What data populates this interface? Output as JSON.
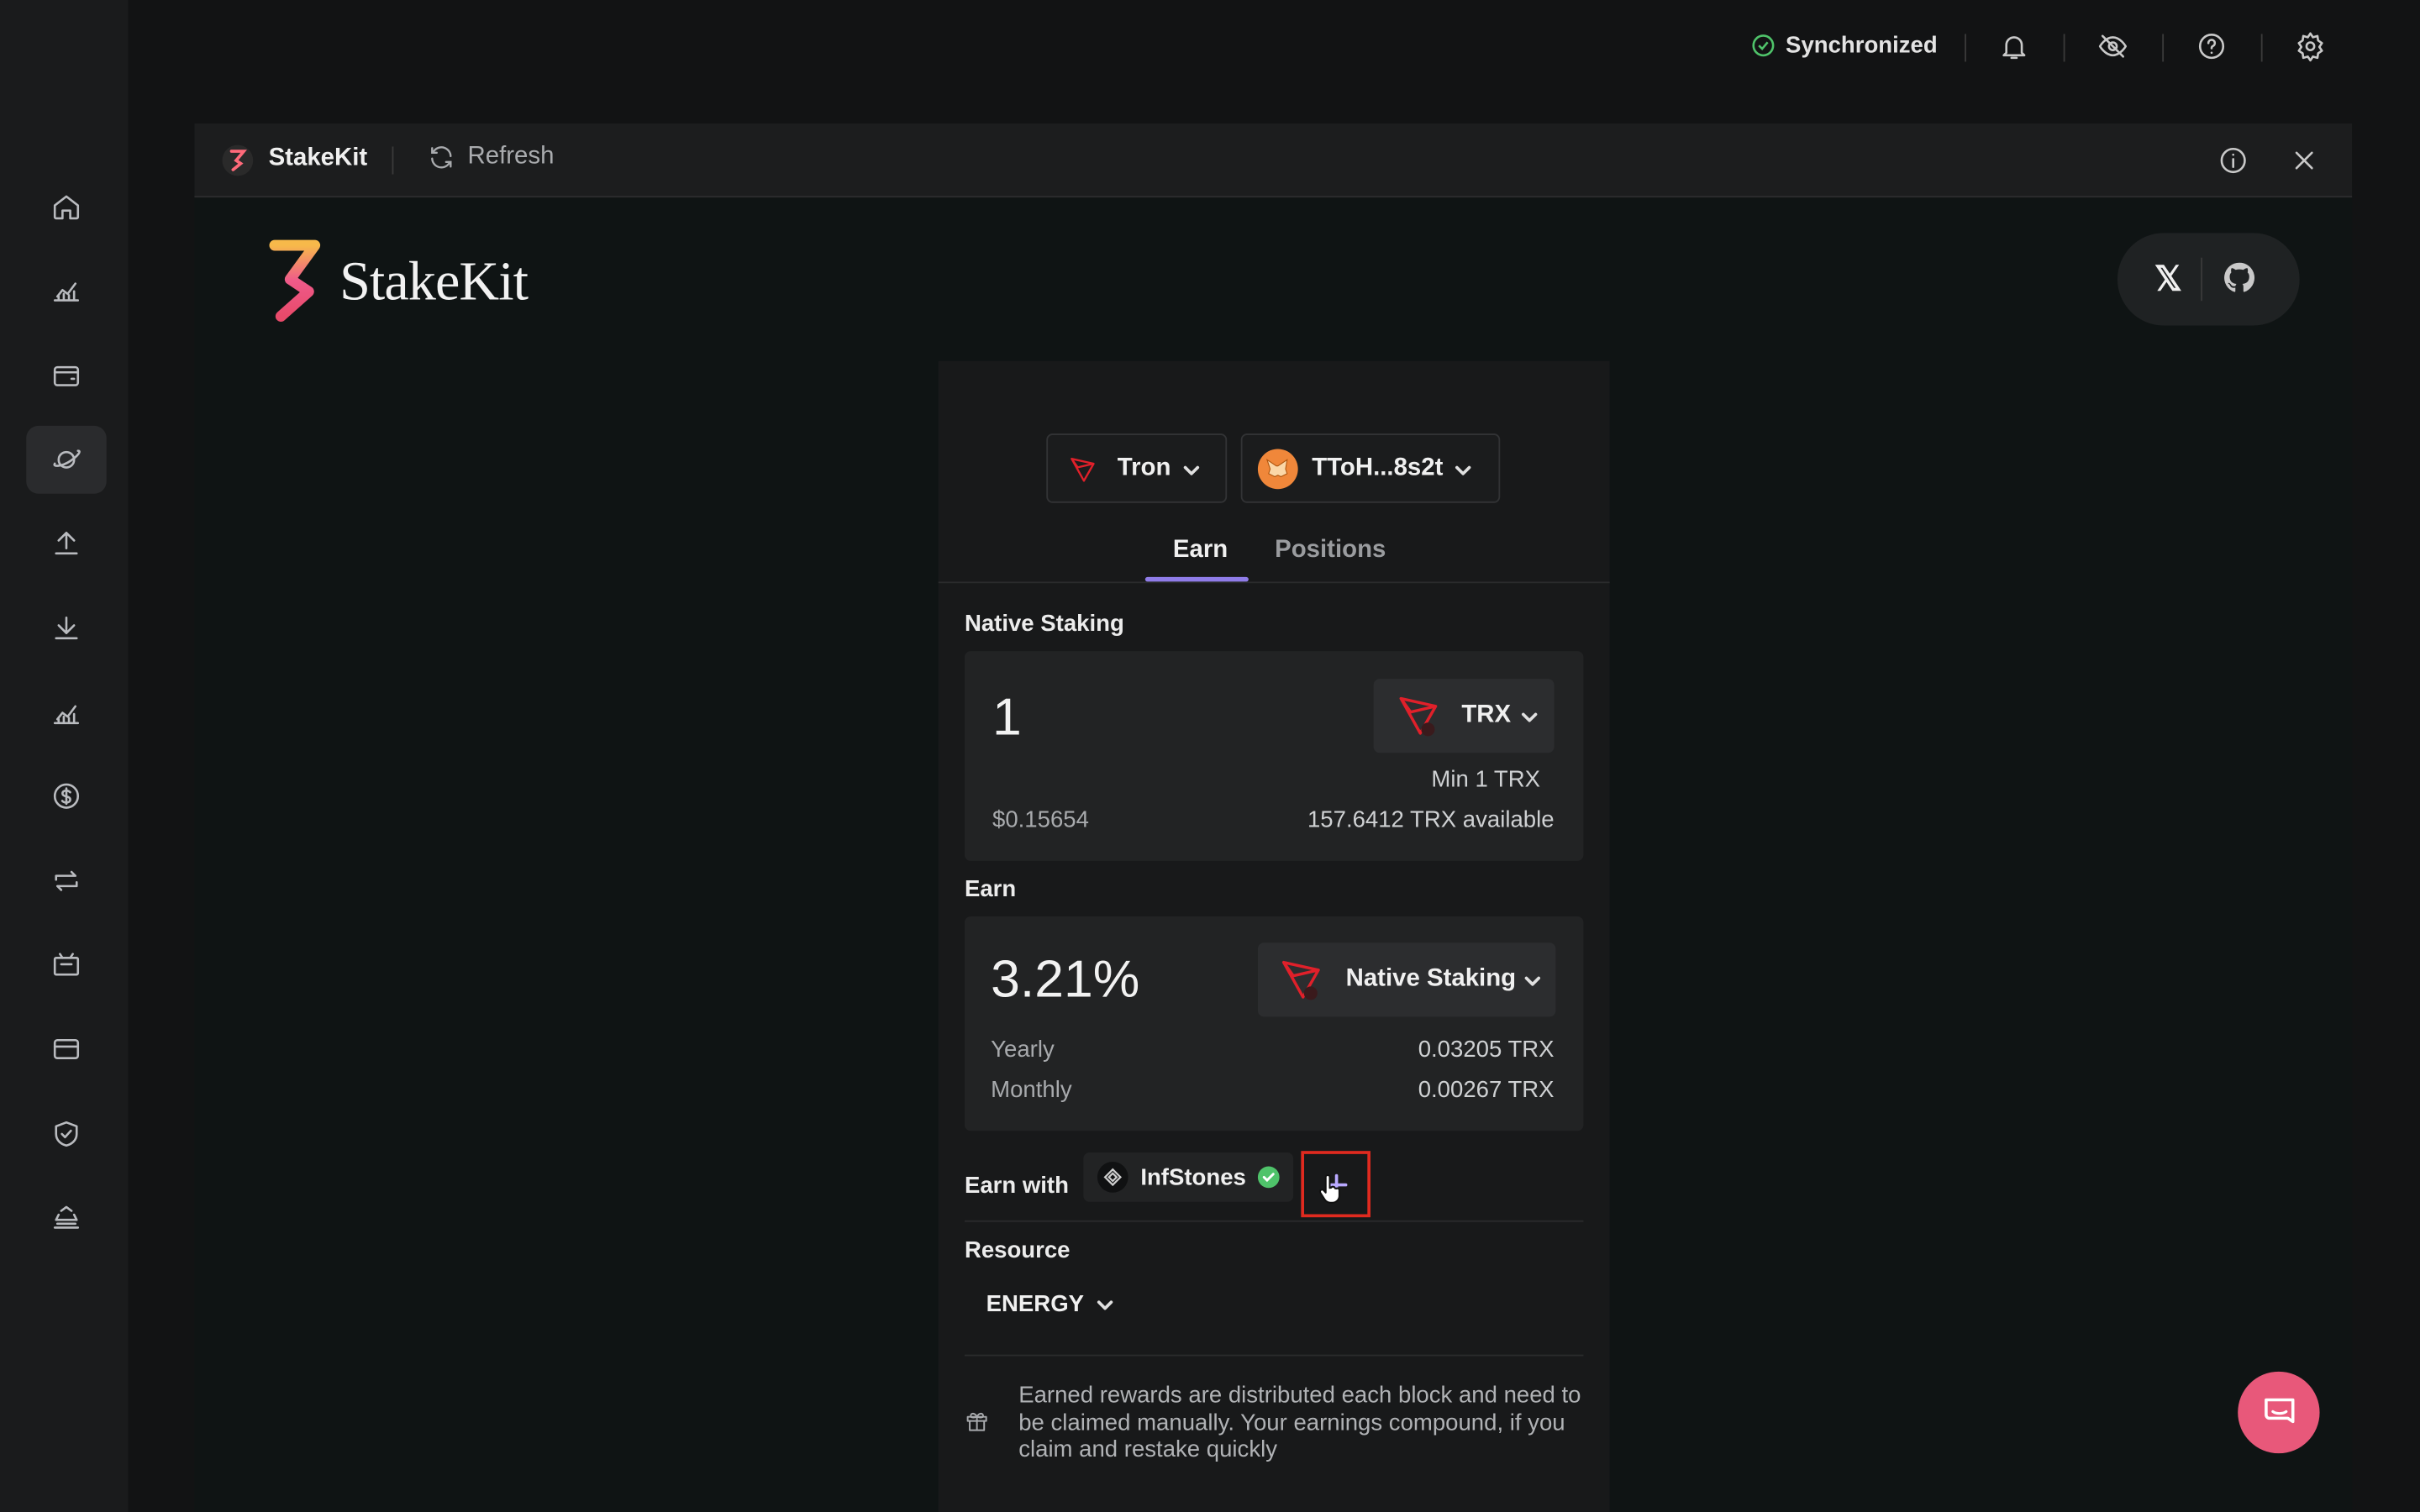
{
  "topbar": {
    "sync_status": "Synchronized"
  },
  "window": {
    "title": "StakeKit",
    "refresh_label": "Refresh"
  },
  "brand": {
    "name": "StakeKit"
  },
  "social": {
    "x_label": "𝕏"
  },
  "selectors": {
    "network": "Tron",
    "wallet": "TToH...8s2t"
  },
  "tabs": {
    "earn": "Earn",
    "positions": "Positions"
  },
  "stake": {
    "section_label": "Native Staking",
    "amount": "1",
    "token": "TRX",
    "min_note": "Min 1 TRX",
    "usd_value": "$0.15654",
    "available": "157.6412 TRX available"
  },
  "earn": {
    "section_label": "Earn",
    "apy": "3.21%",
    "yield_type": "Native Staking",
    "yearly_label": "Yearly",
    "yearly_value": "0.03205 TRX",
    "monthly_label": "Monthly",
    "monthly_value": "0.00267 TRX"
  },
  "earn_with": {
    "label": "Earn with",
    "validator": "InfStones"
  },
  "resource": {
    "label": "Resource",
    "value": "ENERGY"
  },
  "note": {
    "text": "Earned rewards are distributed each block and need to be claimed manually. Your earnings compound, if you claim and restake quickly"
  },
  "colors": {
    "accent": "#8f7ce8",
    "tron_red": "#e0202a",
    "sync_green": "#4fc36a",
    "chat_pink": "#e8587a",
    "highlight_red": "#e02a1f"
  }
}
